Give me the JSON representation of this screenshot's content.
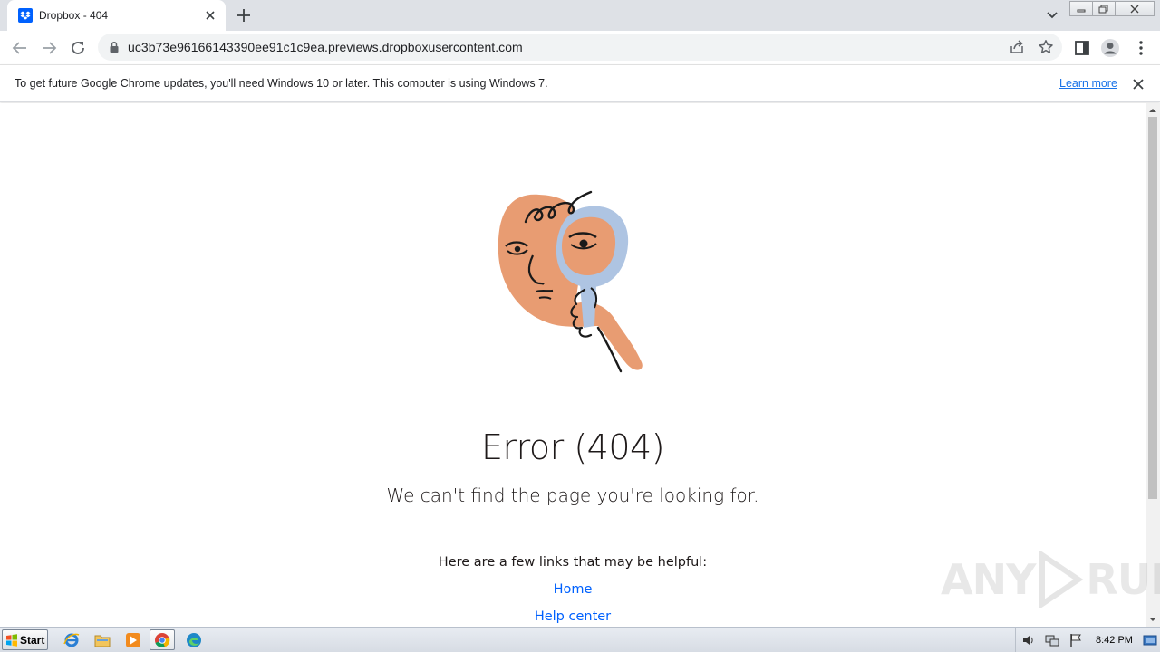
{
  "browser": {
    "tab_title": "Dropbox - 404",
    "url": "uc3b73e96166143390ee91c1c9ea.previews.dropboxusercontent.com"
  },
  "infobar": {
    "message": "To get future Google Chrome updates, you'll need Windows 10 or later. This computer is using Windows 7.",
    "learn_more": "Learn more"
  },
  "page": {
    "title": "Error (404)",
    "subtitle": "We can't find the page you're looking for.",
    "helpful_text": "Here are a few links that may be helpful:",
    "links": [
      "Home",
      "Help center"
    ]
  },
  "watermark": {
    "left": "ANY",
    "right": "RUN"
  },
  "taskbar": {
    "start_label": "Start",
    "clock": "8:42 PM"
  },
  "colors": {
    "accent_blue": "#0061fe",
    "skin": "#e89c72",
    "mirror": "#aec4e2",
    "link_chrome": "#1a73e8"
  }
}
